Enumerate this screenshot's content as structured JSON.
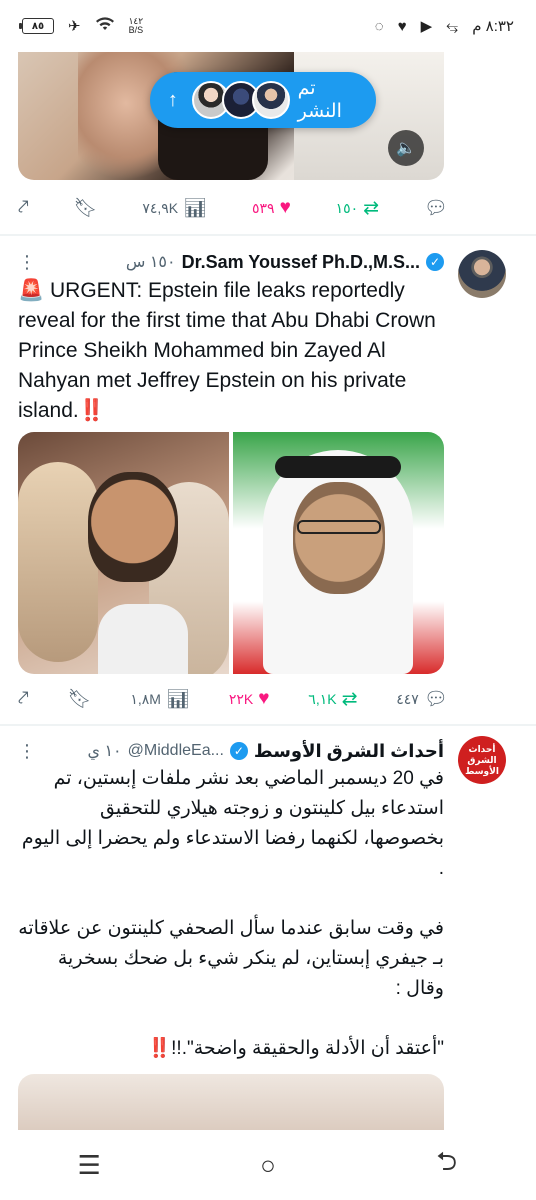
{
  "status_bar": {
    "time": "٨:٣٢ م",
    "battery": "٨٥",
    "net_speed_value": "١٤٢",
    "net_speed_unit": "B/S"
  },
  "top_post": {
    "posted_pill_label": "تم النشر",
    "actions": {
      "reply": "",
      "retweets": "١٥٠",
      "likes": "٥٣٩",
      "views": "٧٤,٩K"
    }
  },
  "tweet1": {
    "name": "Dr.Sam Youssef Ph.D.,M.S...",
    "time": "١٥٠ س",
    "text_parts": {
      "siren": "🚨",
      "body": " URGENT: Epstein file leaks reportedly reveal for the first time that Abu Dhabi Crown Prince Sheikh Mohammed bin Zayed Al Nahyan met Jeffrey Epstein on his private island.",
      "ending": "‼️"
    },
    "actions": {
      "replies": "٤٤٧",
      "retweets": "٦,١K",
      "likes": "٢٢K",
      "views": "١,٨M"
    }
  },
  "tweet2": {
    "name": "أحداث الشرق الأوسط",
    "handle": "@MiddleEa...",
    "time": "١٠ ي",
    "avatar_text": "أحداث الشرق الأوسط",
    "paragraphs": [
      "في 20 ديسمبر الماضي بعد نشر ملفات إبستين، تم استدعاء بيل كلينتون و زوجته هيلاري للتحقيق بخصوصها، لكنهما رفضا الاستدعاء ولم يحضرا إلى اليوم .",
      "في وقت سابق عندما سأل الصحفي كلينتون عن علاقاته بـ جيفري إبستاين، لم ينكر شيء بل ضحك بسخرية وقال :"
    ],
    "quote": "\"أعتقد أن الأدلة والحقيقة واضحة\".!!",
    "quote_mark": "‼️"
  },
  "colors": {
    "accent": "#1d9bf0",
    "retweet": "#00ba7c",
    "like": "#f91880",
    "muted": "#536471"
  }
}
